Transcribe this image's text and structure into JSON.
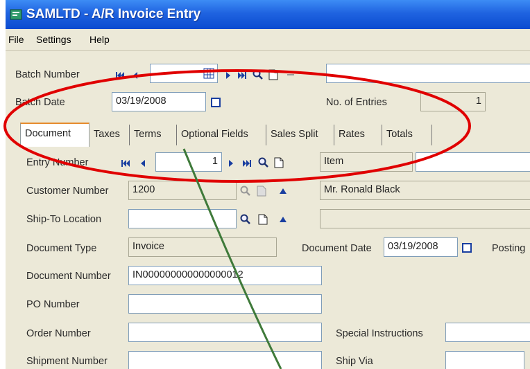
{
  "window": {
    "title": "SAMLTD - A/R Invoice Entry"
  },
  "menu": {
    "file": "File",
    "settings": "Settings",
    "help": "Help"
  },
  "header": {
    "batch_number_label": "Batch Number",
    "batch_number_value": "",
    "batch_desc_value": "",
    "batch_date_label": "Batch Date",
    "batch_date_value": "03/19/2008",
    "entries_label": "No. of Entries",
    "entries_value": "1"
  },
  "tabs": [
    {
      "label": "Document",
      "active": true
    },
    {
      "label": "Taxes"
    },
    {
      "label": "Terms"
    },
    {
      "label": "Optional Fields"
    },
    {
      "label": "Sales Split"
    },
    {
      "label": "Rates"
    },
    {
      "label": "Totals"
    }
  ],
  "document": {
    "entry_number_label": "Entry Number",
    "entry_number_value": "1",
    "item_label": "Item",
    "item_value": "",
    "customer_number_label": "Customer Number",
    "customer_number_value": "1200",
    "customer_name_value": "Mr. Ronald Black",
    "ship_to_label": "Ship-To Location",
    "ship_to_value": "",
    "ship_to_desc": "",
    "doc_type_label": "Document Type",
    "doc_type_value": "Invoice",
    "doc_date_label": "Document Date",
    "doc_date_value": "03/19/2008",
    "posting_label": "Posting",
    "doc_number_label": "Document Number",
    "doc_number_value": "IN000000000000000012",
    "po_label": "PO Number",
    "po_value": "",
    "order_label": "Order Number",
    "order_value": "",
    "special_instructions_label": "Special Instructions",
    "special_instructions_value": "",
    "shipment_label": "Shipment Number",
    "shipment_value": "",
    "ship_via_label": "Ship Via",
    "ship_via_value": ""
  },
  "colors": {
    "titlebar": "#1f63e0",
    "window_bg": "#ece9d8",
    "annotation_ellipse": "#e00000",
    "annotation_line": "#3f7a3a",
    "active_tab_accent": "#e68b2c"
  }
}
